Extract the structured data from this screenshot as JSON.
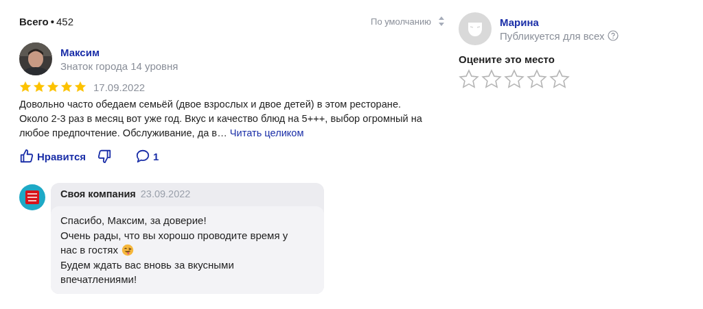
{
  "summary": {
    "label": "Всего",
    "separator": "•",
    "count": "452",
    "sort": "По умолчанию"
  },
  "review": {
    "author": "Максим",
    "level": "Знаток города 14 уровня",
    "stars": 5,
    "date": "17.09.2022",
    "text": "Довольно часто обедаем семьёй (двое взрослых и двое детей) в этом ресторане. Около 2-3 раз в месяц вот уже год. Вкус и качество блюд на 5+++, выбор огромный на любое предпочтение. Обслуживание, да в…",
    "read_more": "Читать целиком",
    "like": "Нравится",
    "comments": "1"
  },
  "reply": {
    "author": "Своя компания",
    "date": "23.09.2022",
    "lines": [
      {
        "text": "Спасибо, Максим, за доверие!",
        "emoji": false
      },
      {
        "text": "Очень рады, что вы хорошо проводите время у",
        "emoji": false
      },
      {
        "text": "нас в гостях",
        "emoji": true
      },
      {
        "text": "Будем ждать вас вновь за вкусными",
        "emoji": false
      },
      {
        "text": "впечатлениями!",
        "emoji": false
      }
    ]
  },
  "user": {
    "name": "Марина",
    "note": "Публикуется для всех",
    "rate_title": "Оцените это место",
    "stars": 0
  }
}
